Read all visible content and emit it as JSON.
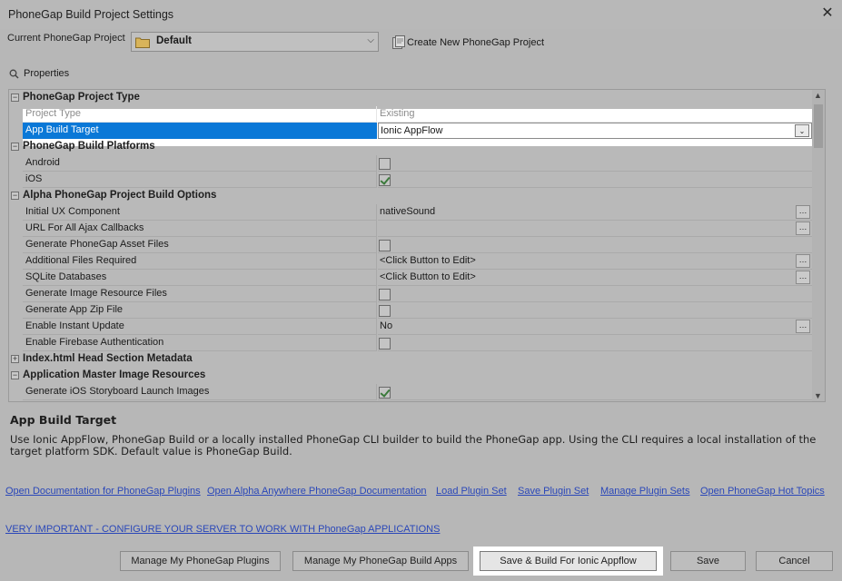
{
  "window": {
    "title": "PhoneGap Build Project Settings"
  },
  "project": {
    "label": "Current PhoneGap Project",
    "selected": "Default",
    "create_label": "Create New PhoneGap Project"
  },
  "properties_label": "Properties",
  "grid": {
    "categories": [
      "PhoneGap Project Type",
      "PhoneGap Build Platforms",
      "Alpha PhoneGap Project Build Options",
      "Index.html Head Section Metadata",
      "Application Master Image Resources"
    ],
    "rows": {
      "project_type": {
        "name": "Project Type",
        "value": "Existing"
      },
      "build_target": {
        "name": "App Build Target",
        "value": "Ionic AppFlow"
      },
      "android": {
        "name": "Android",
        "checked": false
      },
      "ios": {
        "name": "iOS",
        "checked": true
      },
      "initial_ux": {
        "name": "Initial UX Component",
        "value": "nativeSound"
      },
      "ajax_url": {
        "name": "URL For All Ajax Callbacks",
        "value": ""
      },
      "gen_assets": {
        "name": "Generate PhoneGap Asset Files",
        "checked": false
      },
      "add_files": {
        "name": "Additional Files Required",
        "value": "<Click Button to Edit>"
      },
      "sqlite": {
        "name": "SQLite Databases",
        "value": "<Click Button to Edit>"
      },
      "gen_images": {
        "name": "Generate Image Resource Files",
        "checked": false
      },
      "gen_zip": {
        "name": "Generate App Zip File",
        "checked": false
      },
      "instant_update": {
        "name": "Enable Instant Update",
        "value": "No"
      },
      "firebase": {
        "name": "Enable Firebase Authentication",
        "checked": false
      },
      "ios_storyboard": {
        "name": "Generate iOS Storyboard Launch Images",
        "checked": true
      }
    }
  },
  "help": {
    "title": "App Build Target",
    "text": "Use Ionic AppFlow, PhoneGap Build or a locally installed PhoneGap CLI builder to build the PhoneGap app. Using the CLI requires a local installation of the target platform SDK. Default value is PhoneGap Build."
  },
  "links": [
    "Open Documentation for PhoneGap Plugins",
    "Open Alpha Anywhere PhoneGap Documentation",
    "Load Plugin Set",
    "Save Plugin Set",
    "Manage Plugin Sets",
    "Open PhoneGap Hot Topics"
  ],
  "important_link": "VERY IMPORTANT - CONFIGURE YOUR SERVER TO WORK WITH PhoneGap APPLICATIONS",
  "buttons": {
    "manage_plugins": "Manage My PhoneGap Plugins",
    "manage_apps": "Manage My PhoneGap Build Apps",
    "save_build": "Save & Build For Ionic Appflow",
    "save": "Save",
    "cancel": "Cancel"
  },
  "colors": {
    "selection": "#0a78d7",
    "link": "#2a47b8",
    "check": "#3b7a3b"
  }
}
